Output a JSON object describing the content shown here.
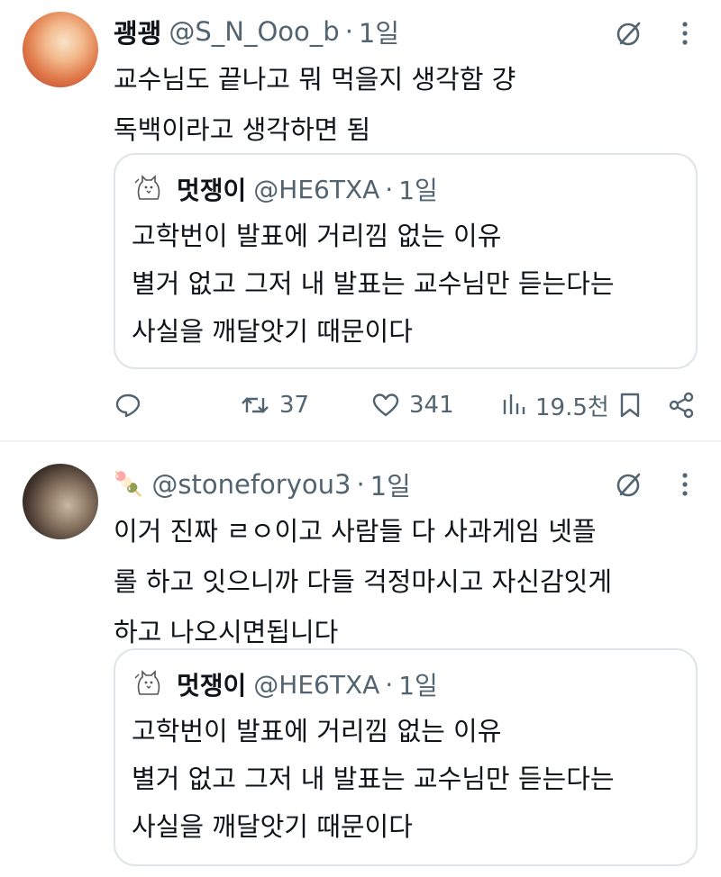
{
  "tweets": [
    {
      "display_name": "괭괭",
      "handle": "@S_N_Ooo_b",
      "time": "1일",
      "lines": [
        "교수님도 끝나고 뭐 먹을지 생각함 걍",
        "독백이라고 생각하면 됨"
      ],
      "quote": {
        "display_name": "멋쟁이",
        "handle": "@HE6TXA",
        "time": "1일",
        "lines": [
          "고학번이 발표에 거리낌 없는 이유",
          "별거 없고 그저 내 발표는 교수님만 듣는다는",
          "사실을 깨달앗기 때문이다"
        ]
      },
      "actions": {
        "retweets": "37",
        "likes": "341",
        "views": "19.5천"
      }
    },
    {
      "badge_emoji": "🍡",
      "handle": "@stoneforyou3",
      "time": "1일",
      "lines": [
        "이거 진짜 ㄹㅇ이고 사람들 다 사과게임 넷플",
        "롤 하고 잇으니까 다들 걱정마시고 자신감잇게",
        "하고 나오시면됩니다"
      ],
      "quote": {
        "display_name": "멋쟁이",
        "handle": "@HE6TXA",
        "time": "1일",
        "lines": [
          "고학번이 발표에 거리낌 없는 이유",
          "별거 없고 그저 내 발표는 교수님만 듣는다는",
          "사실을 깨달앗기 때문이다"
        ]
      }
    }
  ],
  "separator": "·",
  "colors": {
    "text": "#0f1419",
    "secondary": "#536471",
    "border": "#dfe4e8"
  }
}
